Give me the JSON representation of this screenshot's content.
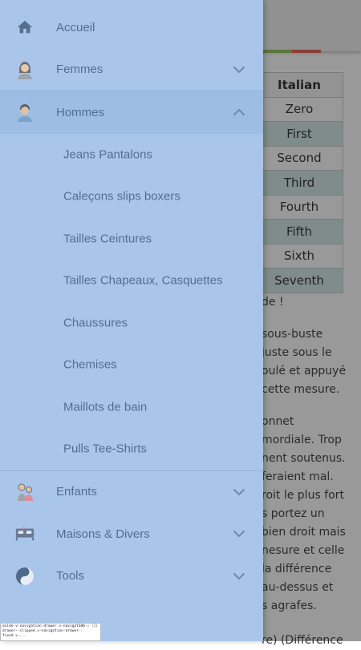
{
  "background": {
    "table": {
      "header": "Italian",
      "rows": [
        "Zero",
        "First",
        "Second",
        "Third",
        "Fourth",
        "Fifth",
        "Sixth",
        "Seventh"
      ]
    },
    "para1": [
      "de !"
    ],
    "para2": [
      "sous-buste",
      "juste sous le",
      "oulé et appuyé",
      "cette mesure."
    ],
    "para3": [
      "onnet",
      "mordiale. Trop",
      "nent soutenus.",
      "feraient mal.",
      "roit le plus fort",
      "s portez un",
      "bien droit mais",
      "nesure et celle",
      "la différence",
      "au-dessus et",
      "s agrafes."
    ],
    "para4": [
      "re) (Différence"
    ]
  },
  "drawer": {
    "items": [
      {
        "label": "Accueil",
        "icon": "home-icon"
      },
      {
        "label": "Femmes",
        "icon": "woman-icon"
      },
      {
        "label": "Hommes",
        "icon": "man-icon"
      }
    ],
    "hommes_sub": [
      "Jeans Pantalons",
      "Caleçons slips boxers",
      "Tailles Ceintures",
      "Tailles Chapeaux, Casquettes",
      "Chaussures",
      "Chemises",
      "Maillots de bain",
      "Pulls Tee-Shirts"
    ],
    "bottom_items": [
      {
        "label": "Enfants",
        "icon": "children-icon"
      },
      {
        "label": "Maisons & Divers",
        "icon": "bed-icon"
      },
      {
        "label": "Tools",
        "icon": "tools-icon"
      }
    ]
  },
  "dev_tooltip": {
    "selector": "aside.v-navigation-drawer.v-navigation-drawer--clipped.v-navigation-drawer--fixed.v-...",
    "size": "300 × 721"
  },
  "colors": {
    "drawer_bg": "#a9c6ea",
    "label": "#4f6e92",
    "teal_row": "#cfe8e6"
  }
}
